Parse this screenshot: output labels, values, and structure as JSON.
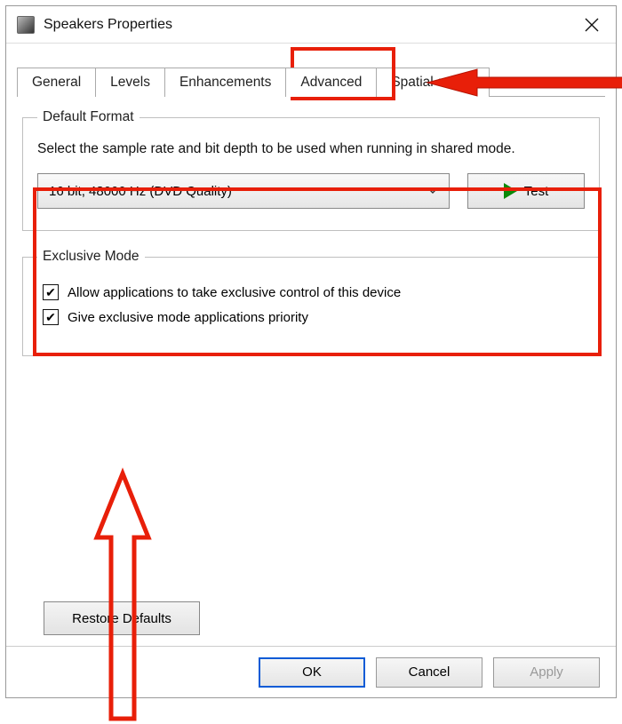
{
  "window": {
    "title": "Speakers Properties"
  },
  "tabs": {
    "items": [
      "General",
      "Levels",
      "Enhancements",
      "Advanced",
      "Spatial sound"
    ],
    "active_index": 3
  },
  "default_format": {
    "legend": "Default Format",
    "description": "Select the sample rate and bit depth to be used when running in shared mode.",
    "selected": "16 bit, 48000 Hz (DVD Quality)",
    "test_label": "Test"
  },
  "exclusive_mode": {
    "legend": "Exclusive Mode",
    "option1": {
      "label": "Allow applications to take exclusive control of this device",
      "checked": true
    },
    "option2": {
      "label": "Give exclusive mode applications priority",
      "checked": true
    }
  },
  "buttons": {
    "restore": "Restore Defaults",
    "ok": "OK",
    "cancel": "Cancel",
    "apply": "Apply"
  },
  "annotations": {
    "highlight_color": "#e81f09"
  }
}
